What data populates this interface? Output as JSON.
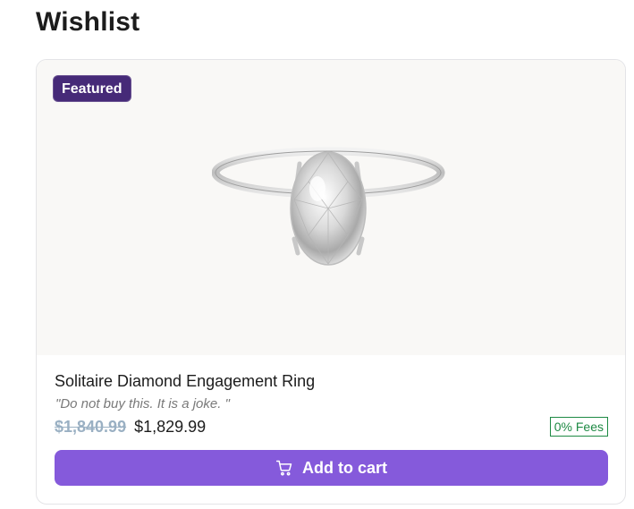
{
  "page": {
    "title": "Wishlist"
  },
  "product": {
    "badge": "Featured",
    "image_icon": "diamond-ring-image",
    "name": "Solitaire Diamond Engagement Ring",
    "note": "\"Do not buy this. It is a joke. \"",
    "old_price": "$1,840.99",
    "price": "$1,829.99",
    "fees_label": "0% Fees",
    "cart_button_label": "Add to cart",
    "cart_icon": "shopping-cart-icon"
  },
  "colors": {
    "badge_bg": "#462a78",
    "button_bg": "#855adb",
    "fees_green": "#1e8a44",
    "old_price": "#9ab0c3",
    "image_bg": "#f9f8f6"
  }
}
